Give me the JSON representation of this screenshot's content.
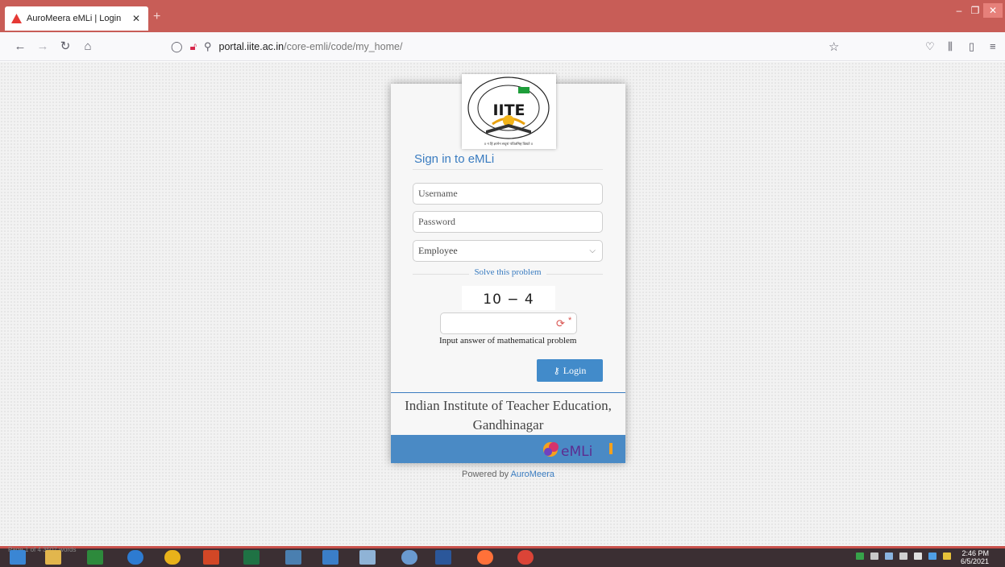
{
  "browser": {
    "tab_title": "AuroMeera eMLi | Login",
    "url_host": "portal.iite.ac.in",
    "url_path": "/core-emli/code/my_home/"
  },
  "login": {
    "heading": "Sign in to eMLi",
    "username_placeholder": "Username",
    "password_placeholder": "Password",
    "role_selected": "Employee",
    "captcha_prompt": "Solve this problem",
    "captcha_expression": "10 − 4",
    "captcha_help": "Input answer of mathematical problem",
    "required_mark": "*",
    "login_label": "Login"
  },
  "institute": {
    "line1": "Indian Institute of Teacher Education,",
    "line2": "Gandhinagar",
    "logo_text": "IITE"
  },
  "footer": {
    "powered_prefix": "Powered by",
    "powered_brand": "AuroMeera",
    "emli_logo_text": "eMLi"
  },
  "taskbar": {
    "time": "2:46 PM",
    "date": "6/5/2021",
    "faded_status": "Page 1 of 4   3507 words"
  },
  "colors": {
    "titlebar": "#c85d57",
    "accent_blue": "#3a7cc0",
    "button_blue": "#428bca",
    "brandbar_blue": "#4a8ac5"
  }
}
